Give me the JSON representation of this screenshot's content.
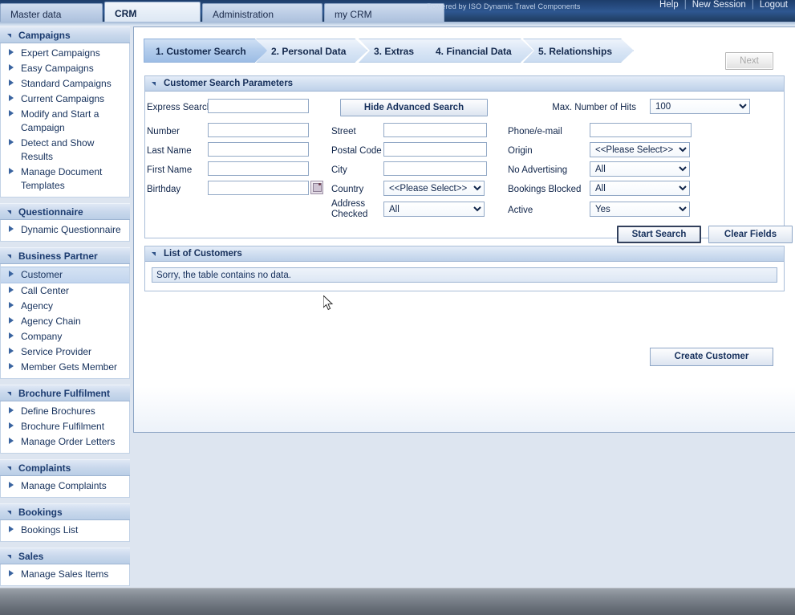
{
  "header": {
    "tabs": [
      {
        "label": "Master data",
        "active": false
      },
      {
        "label": "CRM",
        "active": true
      },
      {
        "label": "Administration",
        "active": false
      },
      {
        "label": "my CRM",
        "active": false
      }
    ],
    "powered_by": "Powered by ISO Dynamic Travel Components",
    "links": [
      "Help",
      "New Session",
      "Logout"
    ],
    "separator": "|"
  },
  "sidebar": {
    "groups": [
      {
        "title": "Campaigns",
        "items": [
          {
            "label": "Expert Campaigns",
            "selected": false
          },
          {
            "label": "Easy Campaigns",
            "selected": false
          },
          {
            "label": "Standard Campaigns",
            "selected": false
          },
          {
            "label": "Current Campaigns",
            "selected": false
          },
          {
            "label": "Modify and Start a Campaign",
            "selected": false
          },
          {
            "label": "Detect and Show Results",
            "selected": false
          },
          {
            "label": "Manage Document Templates",
            "selected": false
          }
        ]
      },
      {
        "title": "Questionnaire",
        "items": [
          {
            "label": "Dynamic Questionnaire",
            "selected": false
          }
        ]
      },
      {
        "title": "Business Partner",
        "items": [
          {
            "label": "Customer",
            "selected": true
          },
          {
            "label": "Call Center",
            "selected": false
          },
          {
            "label": "Agency",
            "selected": false
          },
          {
            "label": "Agency Chain",
            "selected": false
          },
          {
            "label": "Company",
            "selected": false
          },
          {
            "label": "Service Provider",
            "selected": false
          },
          {
            "label": "Member Gets Member",
            "selected": false
          }
        ]
      },
      {
        "title": "Brochure Fulfilment",
        "items": [
          {
            "label": "Define Brochures",
            "selected": false
          },
          {
            "label": "Brochure Fulfilment",
            "selected": false
          },
          {
            "label": "Manage Order Letters",
            "selected": false
          }
        ]
      },
      {
        "title": "Complaints",
        "items": [
          {
            "label": "Manage Complaints",
            "selected": false
          }
        ]
      },
      {
        "title": "Bookings",
        "items": [
          {
            "label": "Bookings List",
            "selected": false
          }
        ]
      },
      {
        "title": "Sales",
        "items": [
          {
            "label": "Manage Sales Items",
            "selected": false
          }
        ]
      }
    ]
  },
  "wizard": {
    "steps": [
      {
        "label": "1. Customer Search",
        "active": true
      },
      {
        "label": "2. Personal Data",
        "active": false
      },
      {
        "label": "3. Extras",
        "active": false
      },
      {
        "label": "4. Financial Data",
        "active": false
      },
      {
        "label": "5. Relationships",
        "active": false
      }
    ],
    "next_label": "Next",
    "next_disabled": true
  },
  "search_panel": {
    "title": "Customer Search Parameters",
    "express_search": {
      "label": "Express Search",
      "value": "",
      "placeholder": ""
    },
    "toggle_advanced_label": "Hide Advanced Search",
    "max_hits": {
      "label": "Max. Number of Hits",
      "value": "100"
    },
    "fields_col1": [
      {
        "label": "Number",
        "value": ""
      },
      {
        "label": "Last Name",
        "value": ""
      },
      {
        "label": "First Name",
        "value": ""
      },
      {
        "label": "Birthday",
        "value": ""
      }
    ],
    "fields_col2": [
      {
        "label": "Street",
        "value": ""
      },
      {
        "label": "Postal Code",
        "value": ""
      },
      {
        "label": "City",
        "value": ""
      }
    ],
    "country": {
      "label": "Country",
      "value": "<<Please Select>>"
    },
    "address_checked": {
      "label": "Address Checked",
      "label_line1": "Address",
      "label_line2": "Checked",
      "value": "All"
    },
    "fields_col3": [
      {
        "label": "Phone/e-mail",
        "type": "text",
        "value": ""
      },
      {
        "label": "Origin",
        "type": "select",
        "value": "<<Please Select>>"
      },
      {
        "label": "No Advertising",
        "type": "select",
        "value": "All"
      },
      {
        "label": "Bookings Blocked",
        "type": "select",
        "value": "All"
      },
      {
        "label": "Active",
        "type": "select",
        "value": "Yes"
      }
    ],
    "start_search_label": "Start Search",
    "clear_fields_label": "Clear Fields"
  },
  "results_panel": {
    "title": "List of Customers",
    "empty_message": "Sorry, the table contains no data."
  },
  "actions": {
    "create_customer_label": "Create Customer"
  },
  "colors": {
    "accent": "#1c3c70",
    "panel_header": "#c9d8ec",
    "page_bg": "#dde5f0",
    "active_step": "#9dbde5"
  }
}
